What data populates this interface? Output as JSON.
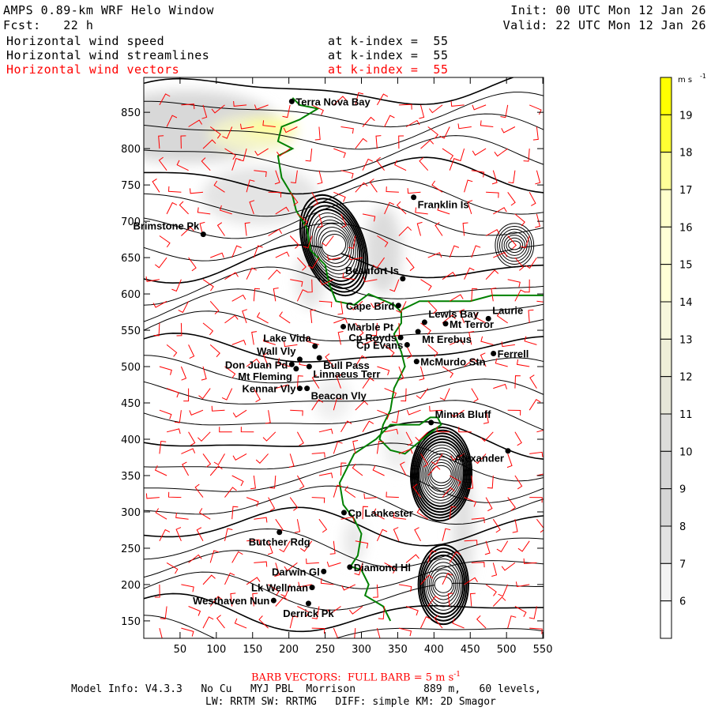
{
  "header": {
    "title": "AMPS 0.89-km WRF Helo Window",
    "init": "Init: 00 UTC Mon 12 Jan 26",
    "fcst": "Fcst:   22 h",
    "valid": "Valid: 22 UTC Mon 12 Jan 26",
    "fields": [
      {
        "name": "Horizontal wind speed",
        "level": "at k-index =  55",
        "color": "#000000"
      },
      {
        "name": "Horizontal wind streamlines",
        "level": "at k-index =  55",
        "color": "#000000"
      },
      {
        "name": "Horizontal wind vectors",
        "level": "at k-index =  55",
        "color": "#ff0000"
      }
    ]
  },
  "map": {
    "xlim": [
      0,
      551
    ],
    "ylim": [
      126,
      898
    ],
    "xticks": [
      "50",
      "100",
      "150",
      "200",
      "250",
      "300",
      "350",
      "400",
      "450",
      "500",
      "550"
    ],
    "yticks": [
      "150",
      "200",
      "250",
      "300",
      "350",
      "400",
      "450",
      "500",
      "550",
      "600",
      "650",
      "700",
      "750",
      "800",
      "850"
    ],
    "coast_color": "#008000",
    "barb_color": "#ff0000",
    "locations": [
      {
        "name": "Terra Nova Bay",
        "x": 204,
        "y": 865,
        "side": "right"
      },
      {
        "name": "Franklin Is",
        "x": 372,
        "y": 733,
        "side": "right-low"
      },
      {
        "name": "Brimstone Pk",
        "x": 82,
        "y": 682,
        "side": "left-up"
      },
      {
        "name": "Beaufort Is",
        "x": 357,
        "y": 621,
        "side": "left-up"
      },
      {
        "name": "Cape Bird",
        "x": 351,
        "y": 584,
        "side": "left"
      },
      {
        "name": "Marble Pt",
        "x": 275,
        "y": 555,
        "side": "right"
      },
      {
        "name": "Lewis Bay",
        "x": 387,
        "y": 561,
        "side": "right-up"
      },
      {
        "name": "Mt Terror",
        "x": 416,
        "y": 559,
        "side": "right"
      },
      {
        "name": "Laurie",
        "x": 475,
        "y": 566,
        "side": "right-up"
      },
      {
        "name": "Cp Royds",
        "x": 354,
        "y": 540,
        "side": "left"
      },
      {
        "name": "Mt Erebus",
        "x": 378,
        "y": 548,
        "side": "right-low"
      },
      {
        "name": "Cp Evans",
        "x": 363,
        "y": 530,
        "side": "left"
      },
      {
        "name": "Lake Vida",
        "x": 236,
        "y": 528,
        "side": "left-up"
      },
      {
        "name": "Ferrell",
        "x": 482,
        "y": 518,
        "side": "right"
      },
      {
        "name": "McMurdo Stn",
        "x": 376,
        "y": 507,
        "side": "right"
      },
      {
        "name": "Bull Pass",
        "x": 242,
        "y": 512,
        "side": "right-low"
      },
      {
        "name": "Wall Vly",
        "x": 215,
        "y": 510,
        "side": "left-up"
      },
      {
        "name": "Don Juan Pd",
        "x": 204,
        "y": 503,
        "side": "left"
      },
      {
        "name": "Linnaeus Terr",
        "x": 228,
        "y": 500,
        "side": "right-low"
      },
      {
        "name": "Mt Fleming",
        "x": 210,
        "y": 497,
        "side": "left-low"
      },
      {
        "name": "Kennar Vly",
        "x": 215,
        "y": 470,
        "side": "left"
      },
      {
        "name": "Beacon Vly",
        "x": 225,
        "y": 470,
        "side": "right-low"
      },
      {
        "name": "Minna Bluff",
        "x": 396,
        "y": 423,
        "side": "right-up"
      },
      {
        "name": "Alexander",
        "x": 502,
        "y": 384,
        "side": "left-low"
      },
      {
        "name": "Cp Lankester",
        "x": 276,
        "y": 299,
        "side": "right"
      },
      {
        "name": "Butcher Rdg",
        "x": 187,
        "y": 272,
        "side": "below"
      },
      {
        "name": "Darwin Gl",
        "x": 248,
        "y": 218,
        "side": "left"
      },
      {
        "name": "Diamond Hl",
        "x": 284,
        "y": 224,
        "side": "right"
      },
      {
        "name": "Lk Wellman",
        "x": 232,
        "y": 196,
        "side": "left"
      },
      {
        "name": "Westhaven Nun",
        "x": 179,
        "y": 178,
        "side": "left"
      },
      {
        "name": "Derrick Pk",
        "x": 227,
        "y": 174,
        "side": "below"
      }
    ]
  },
  "colorbar": {
    "units": "m s",
    "units_exp": "-1",
    "labels": [
      "19",
      "18",
      "17",
      "16",
      "15",
      "14",
      "13",
      "12",
      "11",
      "10",
      "9",
      "8",
      "7",
      "6"
    ],
    "colors": [
      "#ffff00",
      "#ffff33",
      "#ffff99",
      "#ffffcc",
      "#ffffd6",
      "#ffffd6",
      "#f7f7dc",
      "#efefd8",
      "#e6e6d8",
      "#dcdcd9",
      "#d6d6d6",
      "#d6d6d6",
      "#e2e2e2",
      "#f3f3f3",
      "#ffffff"
    ]
  },
  "footer": {
    "barb_note": "BARB VECTORS:  FULL BARB = 5 m s",
    "barb_exp": "-1",
    "model_info": "Model Info: V4.3.3   No Cu   MYJ PBL  Morrison           889 m,   60 levels,",
    "physics": "LW: RRTM SW: RRTMG   DIFF: simple KM: 2D Smagor"
  }
}
